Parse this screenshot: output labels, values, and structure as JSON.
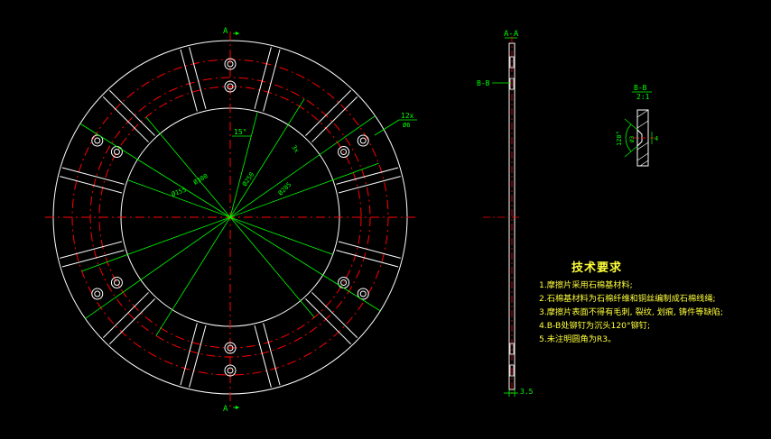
{
  "drawing": {
    "section_a_top": "A",
    "section_a_bottom": "A",
    "section_aa_label": "A-A",
    "section_bb_callout": "B-B",
    "detail_title": "B-B",
    "detail_scale": "2:1",
    "detail_angle": "120°",
    "detail_dim_left": "Ø3",
    "detail_dim_right": "4",
    "dim_angle_15": "15°",
    "dim_hole_count": "12x",
    "dim_hole_dia": "Ø6",
    "dim_d300": "Ø300",
    "dim_d155": "Ø155",
    "dim_d250": "Ø250",
    "dim_d205": "Ø205",
    "dim_small": "3x",
    "dim_thickness": "3.5"
  },
  "tech_requirements": {
    "title": "技术要求",
    "lines": [
      "1.摩擦片采用石棉基材料;",
      "2.石棉基材料为石棉纤维和铜丝编制成石棉线绳;",
      "3.摩擦片表面不得有毛刺, 裂纹, 划痕, 铸件等缺陷;",
      "4.B-B处铆钉为沉头120°铆钉;",
      "5.未注明圆角为R3。"
    ]
  },
  "colors": {
    "outline": "#ffffff",
    "center_line": "#ff0000",
    "dimension": "#00ff00",
    "text": "#ffff3a",
    "accent": "#00ffff"
  }
}
